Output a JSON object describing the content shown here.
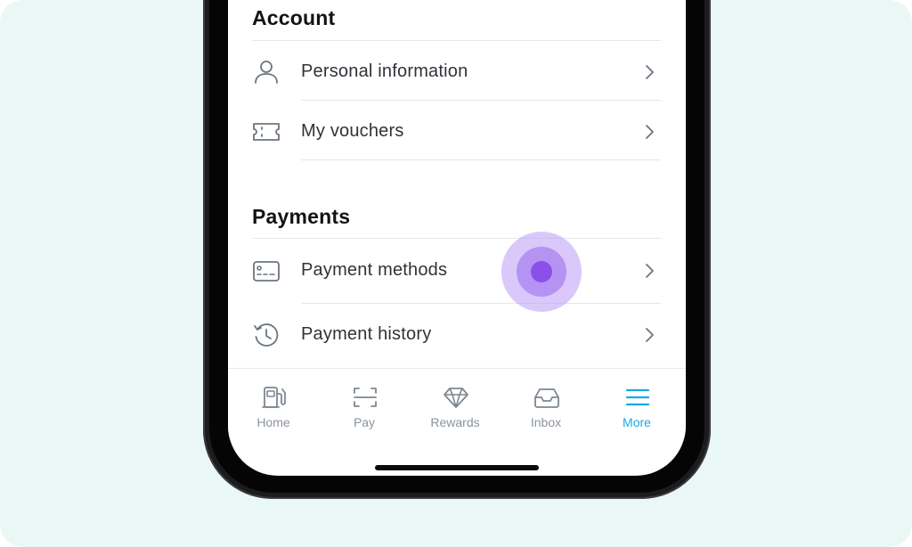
{
  "account": {
    "title": "Account",
    "items": [
      {
        "label": "Personal information",
        "icon": "person-icon"
      },
      {
        "label": "My vouchers",
        "icon": "ticket-icon"
      }
    ]
  },
  "payments": {
    "title": "Payments",
    "items": [
      {
        "label": "Payment methods",
        "icon": "card-icon"
      },
      {
        "label": "Payment history",
        "icon": "history-icon"
      }
    ]
  },
  "tabbar": {
    "items": [
      {
        "label": "Home",
        "icon": "fuel-pump-icon",
        "active": false
      },
      {
        "label": "Pay",
        "icon": "scan-icon",
        "active": false
      },
      {
        "label": "Rewards",
        "icon": "diamond-icon",
        "active": false
      },
      {
        "label": "Inbox",
        "icon": "inbox-icon",
        "active": false
      },
      {
        "label": "More",
        "icon": "menu-icon",
        "active": true
      }
    ]
  },
  "colors": {
    "background": "#eaf8f5",
    "accent": "#1ba7e6",
    "tap_indicator": "#8a4fe8",
    "icon": "#6b7580",
    "text": "#2f3338"
  }
}
